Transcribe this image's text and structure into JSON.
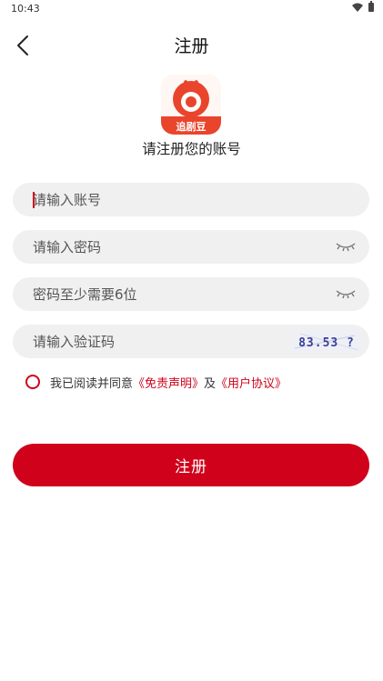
{
  "status_bar": {
    "time": "10:43"
  },
  "header": {
    "title": "注册"
  },
  "logo": {
    "text": "追剧豆",
    "brand_color": "#e9452c"
  },
  "subtitle": "请注册您的账号",
  "form": {
    "account_placeholder": "请输入账号",
    "password_placeholder": "请输入密码",
    "password_hint_placeholder": "密码至少需要6位",
    "captcha_placeholder": "请输入验证码",
    "captcha_text": "83.53 ?"
  },
  "agreement": {
    "prefix": "我已阅读并同意",
    "disclaimer_link": "《免责声明》",
    "joiner": "及",
    "user_agreement_link": "《用户协议》"
  },
  "submit_label": "注册",
  "colors": {
    "accent": "#d0021b",
    "field_bg": "#f0f0f0"
  }
}
